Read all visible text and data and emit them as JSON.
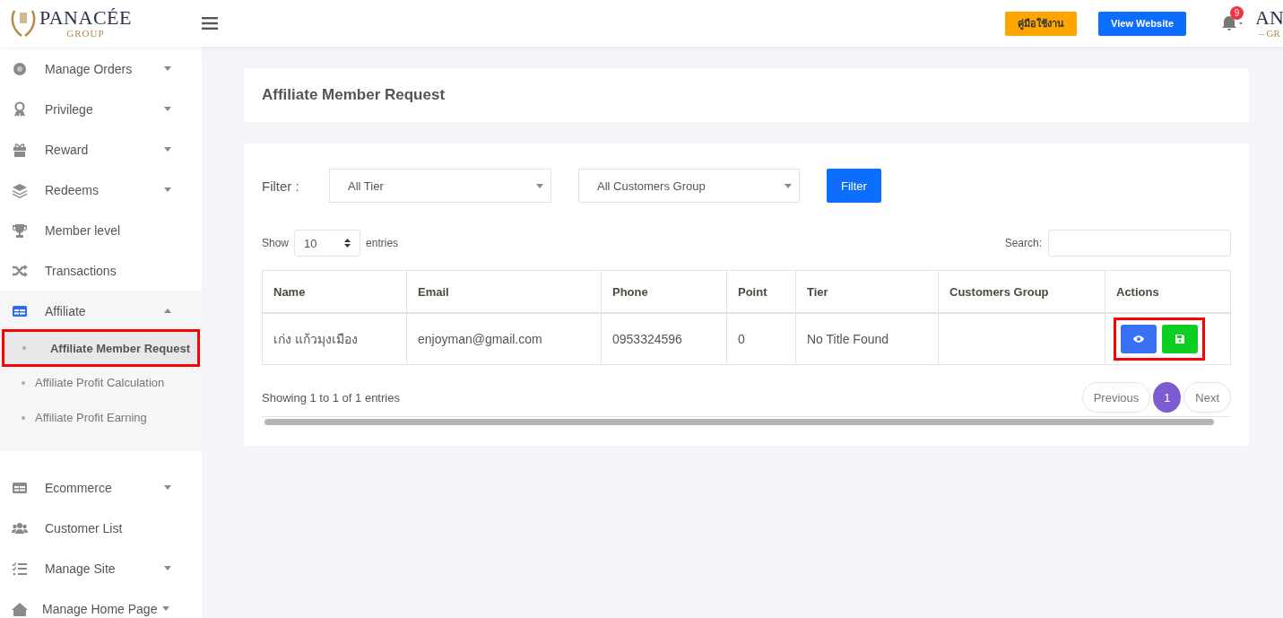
{
  "header": {
    "brand": {
      "name": "PANACÉE",
      "sub": "GROUP"
    },
    "manual_button": "คู่มือใช้งาน",
    "website_button": "View Website",
    "notification_count": "9",
    "profile_logo": {
      "name": "AN",
      "sub": "– GR"
    }
  },
  "sidebar": {
    "items": [
      {
        "label": "Manage Orders",
        "kind": "gear",
        "expandable": true,
        "expanded": false
      },
      {
        "label": "Privilege",
        "kind": "award",
        "expandable": true,
        "expanded": false
      },
      {
        "label": "Reward",
        "kind": "gift",
        "expandable": true,
        "expanded": false
      },
      {
        "label": "Redeems",
        "kind": "layers",
        "expandable": true,
        "expanded": false
      },
      {
        "label": "Member level",
        "kind": "trophy",
        "expandable": false,
        "expanded": false
      },
      {
        "label": "Transactions",
        "kind": "shuffle",
        "expandable": false,
        "expanded": false
      },
      {
        "label": "Affiliate",
        "kind": "table",
        "expandable": true,
        "expanded": true,
        "children": [
          {
            "label": "Affiliate Member Request",
            "selected": true,
            "highlighted": true
          },
          {
            "label": "Affiliate Profit Calculation",
            "selected": false,
            "highlighted": false
          },
          {
            "label": "Affiliate Profit Earning",
            "selected": false,
            "highlighted": false
          }
        ]
      },
      {
        "label": "Ecommerce",
        "kind": "table",
        "expandable": true,
        "expanded": false
      },
      {
        "label": "Customer List",
        "kind": "users",
        "expandable": false,
        "expanded": false
      },
      {
        "label": "Manage Site",
        "kind": "checklist",
        "expandable": true,
        "expanded": false
      },
      {
        "label": "Manage Home Page",
        "kind": "home",
        "expandable": true,
        "expanded": false
      }
    ]
  },
  "page_title": "Affiliate Member Request",
  "filter": {
    "label": "Filter :",
    "tier": "All Tier",
    "group": "All Customers Group",
    "button": "Filter"
  },
  "table": {
    "length_label": "Show",
    "length": "10",
    "entries_label": "entries",
    "search_label": "Search:",
    "columns": [
      "Name",
      "Email",
      "Phone",
      "Point",
      "Tier",
      "Customers Group",
      "Actions"
    ],
    "rows": [
      {
        "cells": [
          "เก่ง แก้วมุงเมือง",
          "enjoyman@gmail.com",
          "0953324596",
          "0",
          "No Title Found",
          ""
        ],
        "actions": [
          {
            "kind": "view"
          },
          {
            "kind": "save"
          }
        ],
        "actions_highlighted": true
      }
    ]
  },
  "info": "Showing 1 to 1 of 1 entries",
  "pagination": {
    "previous": "Previous",
    "pages": [
      {
        "label": "1",
        "selected": true
      }
    ],
    "next": "Next"
  }
}
